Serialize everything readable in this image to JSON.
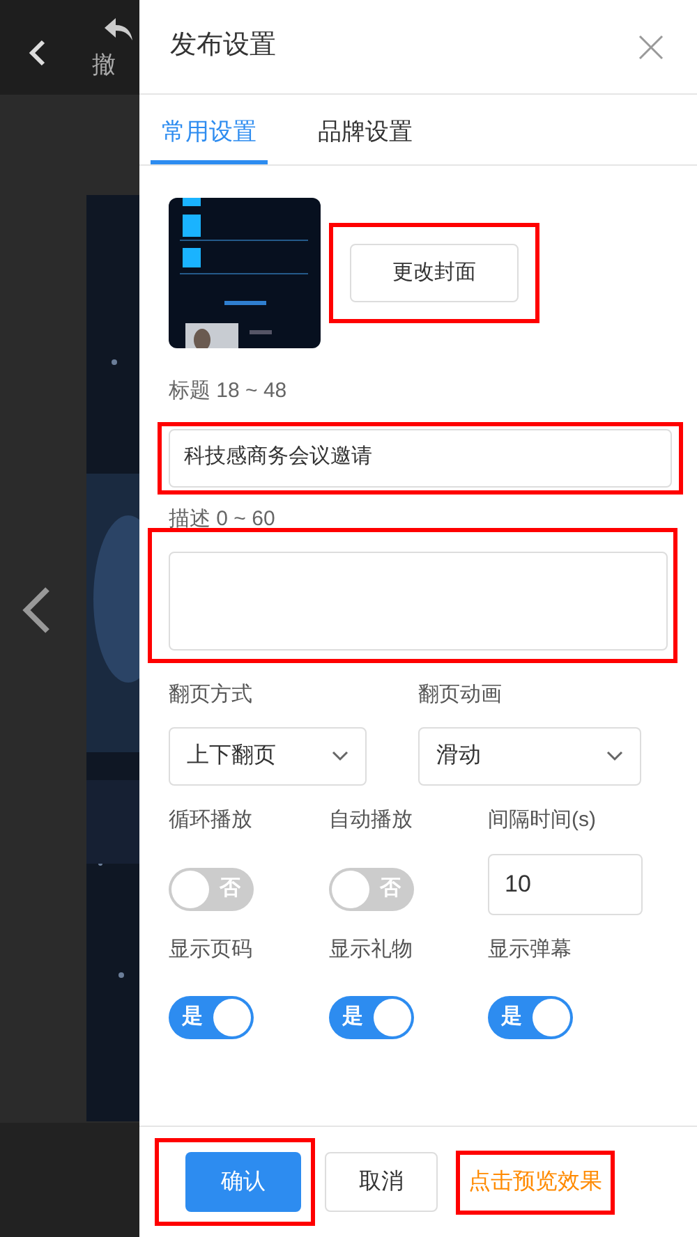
{
  "editor": {
    "undo_label": "撤"
  },
  "dialog": {
    "title": "发布设置",
    "tabs": [
      {
        "label": "常用设置",
        "selected": true
      },
      {
        "label": "品牌设置",
        "selected": false
      }
    ],
    "cover": {
      "button": "更改封面",
      "highlighted": true
    },
    "title_field": {
      "label": "标题 18 ~ 48",
      "value": "科技感商务会议邀请",
      "highlighted": true
    },
    "description_field": {
      "label": "描述 0 ~ 60",
      "highlighted": true
    },
    "settings_rows": [
      {
        "items": [
          {
            "kind": "select",
            "label": "翻页方式",
            "value": "上下翻页"
          },
          {
            "kind": "select",
            "label": "翻页动画",
            "value": "滑动"
          }
        ]
      },
      {
        "items": [
          {
            "kind": "toggle",
            "label": "循环播放",
            "on": false,
            "text": "否"
          },
          {
            "kind": "toggle",
            "label": "自动播放",
            "on": false,
            "text": "否"
          },
          {
            "kind": "number",
            "label": "间隔时间(s)",
            "value": "10"
          }
        ]
      },
      {
        "items": [
          {
            "kind": "toggle",
            "label": "显示页码",
            "on": true,
            "text": "是"
          },
          {
            "kind": "toggle",
            "label": "显示礼物",
            "on": true,
            "text": "是"
          },
          {
            "kind": "toggle",
            "label": "显示弹幕",
            "on": true,
            "text": "是"
          }
        ]
      }
    ],
    "footer": {
      "confirm": {
        "label": "确认",
        "highlighted": true
      },
      "cancel": {
        "label": "取消"
      },
      "preview": {
        "label": "点击预览效果",
        "highlighted": true
      }
    }
  }
}
